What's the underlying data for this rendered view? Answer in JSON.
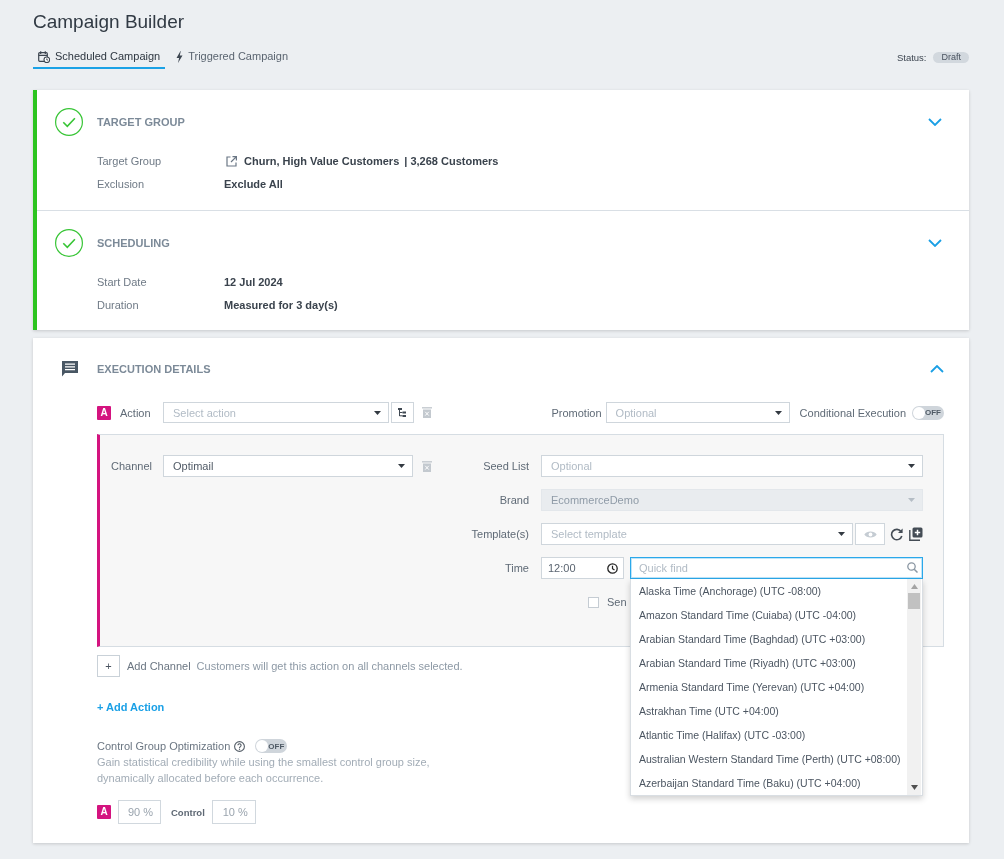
{
  "header": {
    "title": "Campaign Builder",
    "tabs": [
      {
        "kind": "scheduled",
        "label": "Scheduled Campaign",
        "selected": true
      },
      {
        "kind": "triggered",
        "label": "Triggered Campaign",
        "selected": false
      }
    ],
    "status_label": "Status:",
    "status": "Draft"
  },
  "summary_sections": [
    {
      "title": "TARGET GROUP",
      "complete": true,
      "expanded": false,
      "fields": [
        {
          "kind": "link",
          "label": "Target Group",
          "value": "Churn, High Value Customers",
          "count": "| 3,268 Customers"
        },
        {
          "kind": "text",
          "label": "Exclusion",
          "value": "Exclude All"
        }
      ]
    },
    {
      "title": "SCHEDULING",
      "complete": true,
      "expanded": false,
      "fields": [
        {
          "kind": "text",
          "label": "Start Date",
          "value": "12 Jul 2024"
        },
        {
          "kind": "text",
          "label": "Duration",
          "value": "Measured for 3 day(s)"
        }
      ]
    }
  ],
  "execution": {
    "title": "EXECUTION DETAILS",
    "expanded": true,
    "action": {
      "badge": "A",
      "label": "Action",
      "placeholder": "Select action"
    },
    "promotion": {
      "label": "Promotion",
      "placeholder": "Optional"
    },
    "conditional_execution": {
      "label": "Conditional Execution",
      "on": false,
      "toggle_text": "OFF"
    },
    "channel": {
      "label": "Channel",
      "value": "Optimail",
      "fields": [
        {
          "kind": "select",
          "label": "Seed List",
          "placeholder": "Optional",
          "disabled": false
        },
        {
          "kind": "select",
          "label": "Brand",
          "value": "EcommerceDemo",
          "disabled": true
        },
        {
          "kind": "template",
          "label": "Template(s)",
          "placeholder": "Select template",
          "disabled": false
        },
        {
          "kind": "time",
          "label": "Time",
          "value": "12:00",
          "search_placeholder": "Quick find",
          "search_focused": true,
          "options": [
            {
              "label": "Alaska Time (Anchorage) (UTC -08:00)",
              "selected": false
            },
            {
              "label": "Amazon Standard Time (Cuiaba) (UTC -04:00)",
              "selected": false
            },
            {
              "label": "Arabian Standard Time (Baghdad) (UTC +03:00)",
              "selected": false
            },
            {
              "label": "Arabian Standard Time (Riyadh) (UTC +03:00)",
              "selected": false
            },
            {
              "label": "Armenia Standard Time (Yerevan) (UTC +04:00)",
              "selected": false
            },
            {
              "label": "Astrakhan Time (UTC +04:00)",
              "selected": false
            },
            {
              "label": "Atlantic Time (Halifax) (UTC -03:00)",
              "selected": false
            },
            {
              "label": "Australian Western Standard Time (Perth) (UTC +08:00)",
              "selected": false
            },
            {
              "label": "Azerbaijan Standard Time (Baku) (UTC +04:00)",
              "selected": false
            }
          ]
        }
      ],
      "send_checkbox": {
        "label": "Sen",
        "checked": false
      }
    },
    "add_channel": {
      "button": "+",
      "label": "Add Channel",
      "note": "Customers will get this action on all channels selected."
    },
    "add_action": "+ Add Action",
    "control_group": {
      "label": "Control Group Optimization",
      "on": false,
      "toggle_text": "OFF",
      "description": "Gain statistical credibility while using the smallest control group size, dynamically allocated before each occurrence.",
      "variant_badge": "A",
      "variant_value": "90 %",
      "control_label": "Control",
      "control_value": "10 %"
    }
  }
}
